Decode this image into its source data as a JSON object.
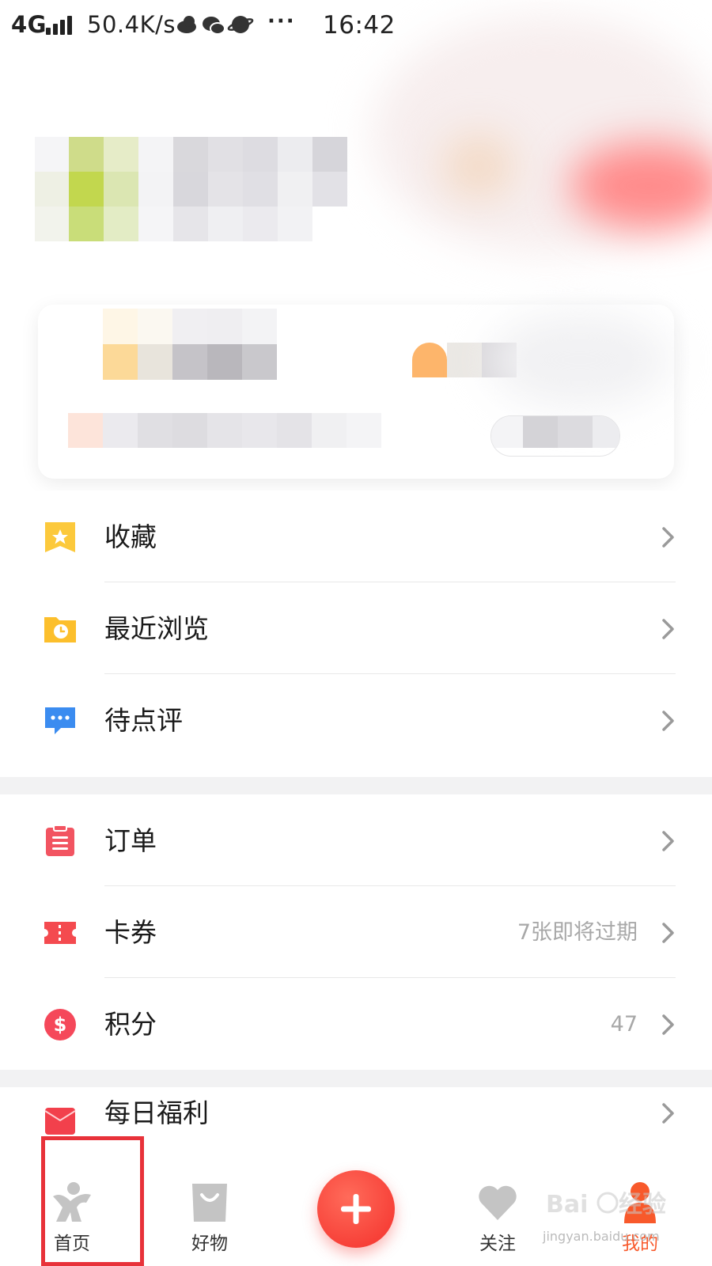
{
  "status_bar": {
    "network": "4G",
    "speed": "50.4K/s",
    "more": "···",
    "time": "16:42"
  },
  "menu": {
    "group1": [
      {
        "id": "favorites",
        "label": "收藏",
        "extra": "",
        "icon": "bookmark-star-icon"
      },
      {
        "id": "recent",
        "label": "最近浏览",
        "extra": "",
        "icon": "folder-clock-icon"
      },
      {
        "id": "to-review",
        "label": "待点评",
        "extra": "",
        "icon": "chat-bubble-icon"
      }
    ],
    "group2": [
      {
        "id": "orders",
        "label": "订单",
        "extra": "",
        "icon": "clipboard-icon"
      },
      {
        "id": "coupons",
        "label": "卡券",
        "extra": "7张即将过期",
        "icon": "ticket-icon"
      },
      {
        "id": "points",
        "label": "积分",
        "extra": "47",
        "icon": "dollar-coin-icon"
      }
    ],
    "group3": [
      {
        "id": "daily-benefits",
        "label": "每日福利",
        "extra": "",
        "icon": "gift-envelope-icon"
      }
    ]
  },
  "tab_bar": {
    "tabs": [
      {
        "id": "home",
        "label": "首页",
        "icon": "home-person-icon"
      },
      {
        "id": "goods",
        "label": "好物",
        "icon": "shopping-bag-icon"
      },
      {
        "id": "follow",
        "label": "关注",
        "icon": "heart-icon"
      },
      {
        "id": "mine",
        "label": "我的",
        "icon": "person-icon"
      }
    ],
    "fab_icon": "plus-icon"
  },
  "watermark": {
    "text": "jingyan.baidu.com",
    "logo": "Baidu 经验"
  },
  "colors": {
    "accent": "#f4302b",
    "highlight_box": "#e8323a",
    "extra_text": "#a8a8a8",
    "section_gap": "#f2f2f3"
  }
}
